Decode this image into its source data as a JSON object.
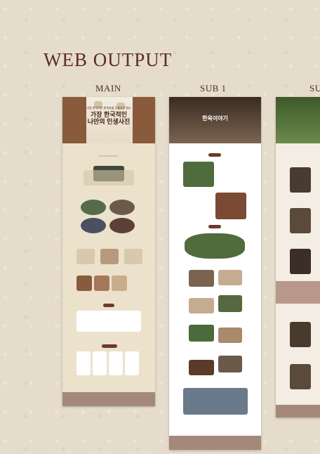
{
  "page": {
    "title": "WEB OUTPUT"
  },
  "columns": [
    {
      "label": "MAIN"
    },
    {
      "label": "SUB 1"
    },
    {
      "label": "SU"
    }
  ],
  "main": {
    "hero_small": "가장 한국적인 한옥마을 인생사진 명소",
    "hero_line1": "가장 한국적인",
    "hero_line2": "나만의 인생사진"
  },
  "sub1": {
    "hero_text": "한옥이야기"
  }
}
